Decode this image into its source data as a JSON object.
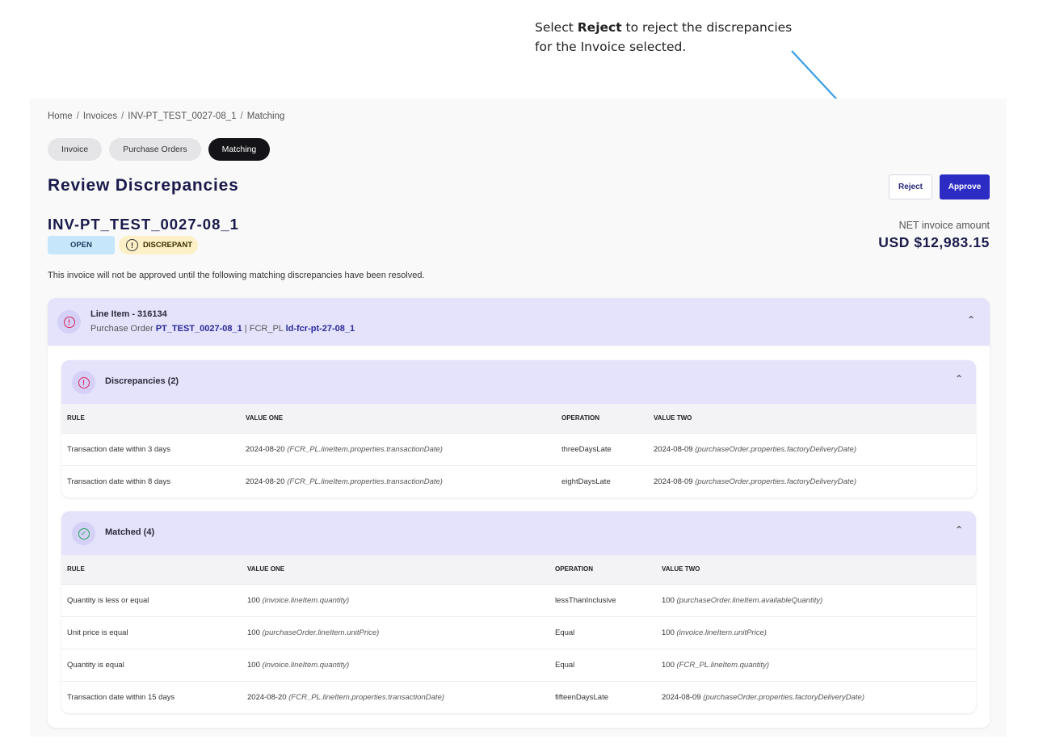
{
  "callout": {
    "prefix": "Select ",
    "bold": "Reject",
    "suffix": " to reject the discrepancies for the Invoice selected."
  },
  "breadcrumb": [
    "Home",
    "Invoices",
    "INV-PT_TEST_0027-08_1",
    "Matching"
  ],
  "breadcrumb_sep": "/",
  "tabs": [
    {
      "label": "Invoice",
      "active": false
    },
    {
      "label": "Purchase Orders",
      "active": false
    },
    {
      "label": "Matching",
      "active": true
    }
  ],
  "page_title": "Review Discrepancies",
  "actions": {
    "reject": "Reject",
    "approve": "Approve"
  },
  "invoice": {
    "id": "INV-PT_TEST_0027-08_1",
    "status": "OPEN",
    "flag": "DISCREPANT",
    "net_label": "NET invoice amount",
    "net_amount": "USD $12,983.15"
  },
  "notice": "This invoice will not be approved until the following matching discrepancies have been resolved.",
  "line_item": {
    "title": "Line Item - 316134",
    "po_label": "Purchase Order",
    "po_value": "PT_TEST_0027-08_1",
    "fcr_label": "FCR_PL",
    "fcr_value": "ld-fcr-pt-27-08_1"
  },
  "discrepancies": {
    "title": "Discrepancies (2)",
    "columns": [
      "RULE",
      "VALUE ONE",
      "OPERATION",
      "VALUE TWO"
    ],
    "rows": [
      {
        "rule": "Transaction date within 3 days",
        "v1": "2024-08-20",
        "v1_src": "(FCR_PL.lineItem.properties.transactionDate)",
        "op": "threeDaysLate",
        "v2": "2024-08-09",
        "v2_src": "(purchaseOrder.properties.factoryDeliveryDate)"
      },
      {
        "rule": "Transaction date within 8 days",
        "v1": "2024-08-20",
        "v1_src": "(FCR_PL.lineItem.properties.transactionDate)",
        "op": "eightDaysLate",
        "v2": "2024-08-09",
        "v2_src": "(purchaseOrder.properties.factoryDeliveryDate)"
      }
    ]
  },
  "matched": {
    "title": "Matched (4)",
    "columns": [
      "RULE",
      "VALUE ONE",
      "OPERATION",
      "VALUE TWO"
    ],
    "rows": [
      {
        "rule": "Quantity is less or equal",
        "v1": "100",
        "v1_src": "(invoice.lineItem.quantity)",
        "op": "lessThanInclusive",
        "v2": "100",
        "v2_src": "(purchaseOrder.lineItem.availableQuantity)"
      },
      {
        "rule": "Unit price is equal",
        "v1": "100",
        "v1_src": "(purchaseOrder.lineItem.unitPrice)",
        "op": "Equal",
        "v2": "100",
        "v2_src": "(invoice.lineItem.unitPrice)"
      },
      {
        "rule": "Quantity is equal",
        "v1": "100",
        "v1_src": "(invoice.lineItem.quantity)",
        "op": "Equal",
        "v2": "100",
        "v2_src": "(FCR_PL.lineItem.quantity)"
      },
      {
        "rule": "Transaction date within 15 days",
        "v1": "2024-08-20",
        "v1_src": "(FCR_PL.lineItem.properties.transactionDate)",
        "op": "fifteenDaysLate",
        "v2": "2024-08-09",
        "v2_src": "(purchaseOrder.properties.factoryDeliveryDate)"
      }
    ]
  },
  "colors": {
    "accent": "#2c2cc4",
    "header_bg": "#e4e3fb",
    "arrow": "#3a9ee6",
    "error": "#e0245e",
    "success": "#23a55a"
  }
}
